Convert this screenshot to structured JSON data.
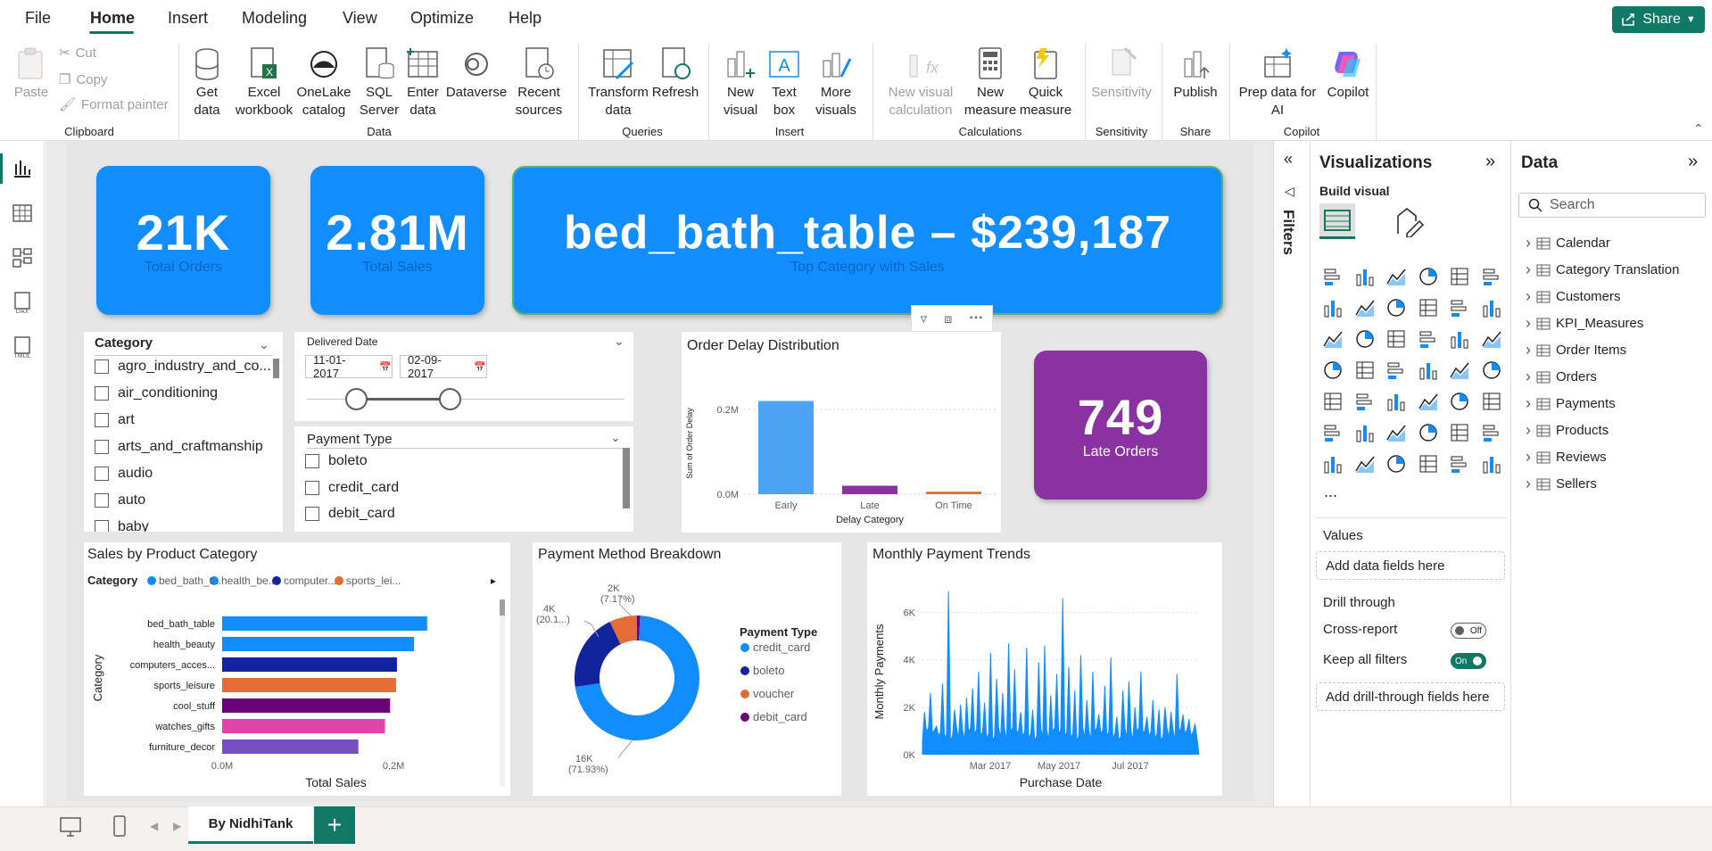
{
  "menu": {
    "items": [
      "File",
      "Home",
      "Insert",
      "Modeling",
      "View",
      "Optimize",
      "Help"
    ],
    "active": "Home",
    "share_label": "Share"
  },
  "ribbon": {
    "clipboard": {
      "paste": "Paste",
      "cut": "Cut",
      "copy": "Copy",
      "format_painter": "Format painter",
      "group": "Clipboard"
    },
    "data": {
      "get_data": "Get data",
      "excel": "Excel workbook",
      "onelake": "OneLake catalog",
      "sql": "SQL Server",
      "enter": "Enter data",
      "dataverse": "Dataverse",
      "recent": "Recent sources",
      "group": "Data"
    },
    "queries": {
      "transform": "Transform data",
      "refresh": "Refresh",
      "group": "Queries"
    },
    "insert": {
      "new_visual": "New visual",
      "text_box": "Text box",
      "more_visuals": "More visuals",
      "group": "Insert"
    },
    "calculations": {
      "new_visual_calc": "New visual calculation",
      "new_measure": "New measure",
      "quick_measure": "Quick measure",
      "group": "Calculations"
    },
    "sensitivity": {
      "label": "Sensitivity",
      "group": "Sensitivity"
    },
    "share": {
      "publish": "Publish",
      "group": "Share"
    },
    "copilot": {
      "prep": "Prep data for AI",
      "copilot": "Copilot",
      "group": "Copilot"
    }
  },
  "cards": {
    "total_orders": {
      "value": "21K",
      "label": "Total Orders"
    },
    "total_sales": {
      "value": "2.81M",
      "label": "Total Sales"
    },
    "top_category": {
      "value": "bed_bath_table – $239,187",
      "label": "Top Category with Sales"
    },
    "late_orders": {
      "value": "749",
      "label": "Late Orders"
    }
  },
  "category_slicer": {
    "title": "Category",
    "items": [
      "agro_industry_and_co...",
      "air_conditioning",
      "art",
      "arts_and_craftmanship",
      "audio",
      "auto",
      "baby"
    ]
  },
  "date_slicer": {
    "title": "Delivered Date",
    "start": "11-01-2017",
    "end": "02-09-2017"
  },
  "payment_slicer": {
    "title": "Payment Type",
    "items": [
      "boleto",
      "credit_card",
      "debit_card"
    ]
  },
  "colors": {
    "accent": "#117865",
    "card_blue": "#118dff",
    "card_purple": "#8a33a0"
  },
  "chart_data": [
    {
      "type": "bar",
      "title": "Order Delay Distribution",
      "categories": [
        "Early",
        "Late",
        "On Time"
      ],
      "values": [
        220000,
        20000,
        6000
      ],
      "colors": [
        "#4aa3f5",
        "#8a33a0",
        "#e66c37"
      ],
      "xlabel": "Delay Category",
      "ylabel": "Sum of Order Delay",
      "yticks": [
        "0.0M",
        "0.2M"
      ],
      "ylim": [
        0,
        240000
      ]
    },
    {
      "type": "bar",
      "orientation": "horizontal",
      "title": "Sales by Product Category",
      "legend_title": "Category",
      "legend": [
        "bed_bath_t...",
        "health_be...",
        "computer...",
        "sports_lei..."
      ],
      "categories": [
        "bed_bath_table",
        "health_beauty",
        "computers_acces...",
        "sports_leisure",
        "cool_stuff",
        "watches_gifts",
        "furniture_decor"
      ],
      "values": [
        239187,
        224000,
        204000,
        203000,
        196000,
        190000,
        159000
      ],
      "colors": [
        "#118dff",
        "#118dff",
        "#12239e",
        "#e66c37",
        "#6b007b",
        "#e044a7",
        "#744ec2"
      ],
      "xlabel": "Total Sales",
      "ylabel": "Category",
      "xticks": [
        "0.0M",
        "0.2M"
      ],
      "xlim": [
        0,
        300000
      ]
    },
    {
      "type": "pie",
      "title": "Payment Method Breakdown",
      "legend_title": "Payment Type",
      "labels": [
        "credit_card",
        "boleto",
        "voucher",
        "debit_card"
      ],
      "percent": [
        71.93,
        20.1,
        7.17,
        0.8
      ],
      "colors": [
        "#118dff",
        "#12239e",
        "#e66c37",
        "#6b007b"
      ],
      "data_labels": [
        {
          "value": "16K",
          "pct": "(71.93%)"
        },
        {
          "value": "4K",
          "pct": "(20.1...)"
        },
        {
          "value": "2K",
          "pct": "(7.17%)"
        }
      ]
    },
    {
      "type": "area",
      "title": "Monthly Payment Trends",
      "xlabel": "Purchase Date",
      "ylabel": "Monthly Payments",
      "xticks": [
        "Mar 2017",
        "May 2017",
        "Jul 2017"
      ],
      "yticks": [
        "0K",
        "2K",
        "4K",
        "6K"
      ],
      "ylim": [
        0,
        7000
      ],
      "peaks": [
        1800,
        2600,
        1200,
        3000,
        6900,
        1900,
        2100,
        2400,
        2800,
        3500,
        2200,
        4300,
        3200,
        2600,
        4700,
        3600,
        1800,
        4500,
        1900,
        3900,
        4600,
        2500,
        3400,
        6600,
        3700,
        2700,
        4200,
        2300,
        3500,
        1700,
        2900,
        4100,
        1600,
        2700,
        3100,
        2000,
        3500,
        1600,
        2300,
        1900,
        2000,
        1800,
        3400,
        1700,
        1500,
        1300
      ]
    }
  ],
  "visual_header": {
    "filter": "filter-icon",
    "focus": "focus-icon",
    "more": "more-options-icon"
  },
  "filters_label": "Filters",
  "visualizations": {
    "title": "Visualizations",
    "build_visual": "Build visual",
    "values_label": "Values",
    "values_placeholder": "Add data fields here",
    "drill_label": "Drill through",
    "cross_report": "Cross-report",
    "cross_report_state": "Off",
    "keep_filters": "Keep all filters",
    "keep_filters_state": "On",
    "drill_placeholder": "Add drill-through fields here",
    "more": "..."
  },
  "data_pane": {
    "title": "Data",
    "search_placeholder": "Search",
    "tables": [
      "Calendar",
      "Category Translation",
      "Customers",
      "KPI_Measures",
      "Order Items",
      "Orders",
      "Payments",
      "Products",
      "Reviews",
      "Sellers"
    ]
  },
  "tabs": {
    "page": "By NidhiTank",
    "add": "+"
  }
}
